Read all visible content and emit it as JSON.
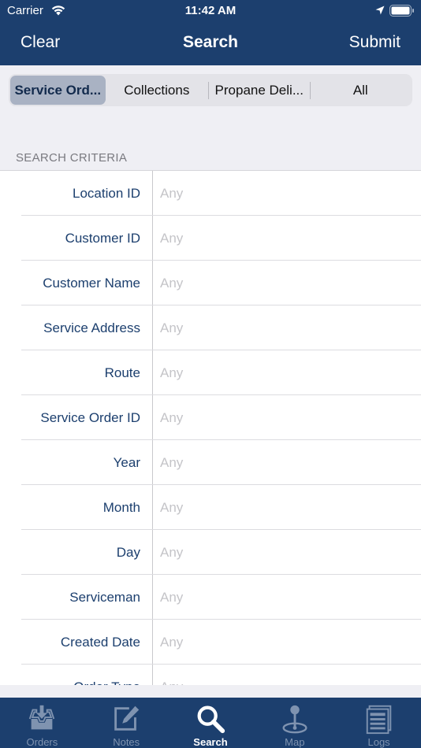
{
  "status_bar": {
    "carrier": "Carrier",
    "time": "11:42 AM"
  },
  "nav": {
    "left": "Clear",
    "title": "Search",
    "right": "Submit"
  },
  "segments": [
    {
      "label": "Service Ord...",
      "selected": true
    },
    {
      "label": "Collections",
      "selected": false
    },
    {
      "label": "Propane Deli...",
      "selected": false
    },
    {
      "label": "All",
      "selected": false
    }
  ],
  "section_title": "SEARCH CRITERIA",
  "fields": [
    {
      "label": "Location ID",
      "placeholder": "Any",
      "value": ""
    },
    {
      "label": "Customer ID",
      "placeholder": "Any",
      "value": ""
    },
    {
      "label": "Customer Name",
      "placeholder": "Any",
      "value": ""
    },
    {
      "label": "Service Address",
      "placeholder": "Any",
      "value": ""
    },
    {
      "label": "Route",
      "placeholder": "Any",
      "value": ""
    },
    {
      "label": "Service Order ID",
      "placeholder": "Any",
      "value": ""
    },
    {
      "label": "Year",
      "placeholder": "Any",
      "value": ""
    },
    {
      "label": "Month",
      "placeholder": "Any",
      "value": ""
    },
    {
      "label": "Day",
      "placeholder": "Any",
      "value": ""
    },
    {
      "label": "Serviceman",
      "placeholder": "Any",
      "value": ""
    },
    {
      "label": "Created Date",
      "placeholder": "Any",
      "value": ""
    },
    {
      "label": "Order Type",
      "placeholder": "Any",
      "value": ""
    }
  ],
  "tabs": [
    {
      "label": "Orders",
      "icon": "inbox-download-icon",
      "active": false
    },
    {
      "label": "Notes",
      "icon": "edit-note-icon",
      "active": false
    },
    {
      "label": "Search",
      "icon": "search-icon",
      "active": true
    },
    {
      "label": "Map",
      "icon": "map-pin-icon",
      "active": false
    },
    {
      "label": "Logs",
      "icon": "logs-icon",
      "active": false
    }
  ],
  "colors": {
    "brand": "#1c3f6e",
    "selected_segment": "#a9b2c3",
    "placeholder": "#c4c4c8"
  }
}
